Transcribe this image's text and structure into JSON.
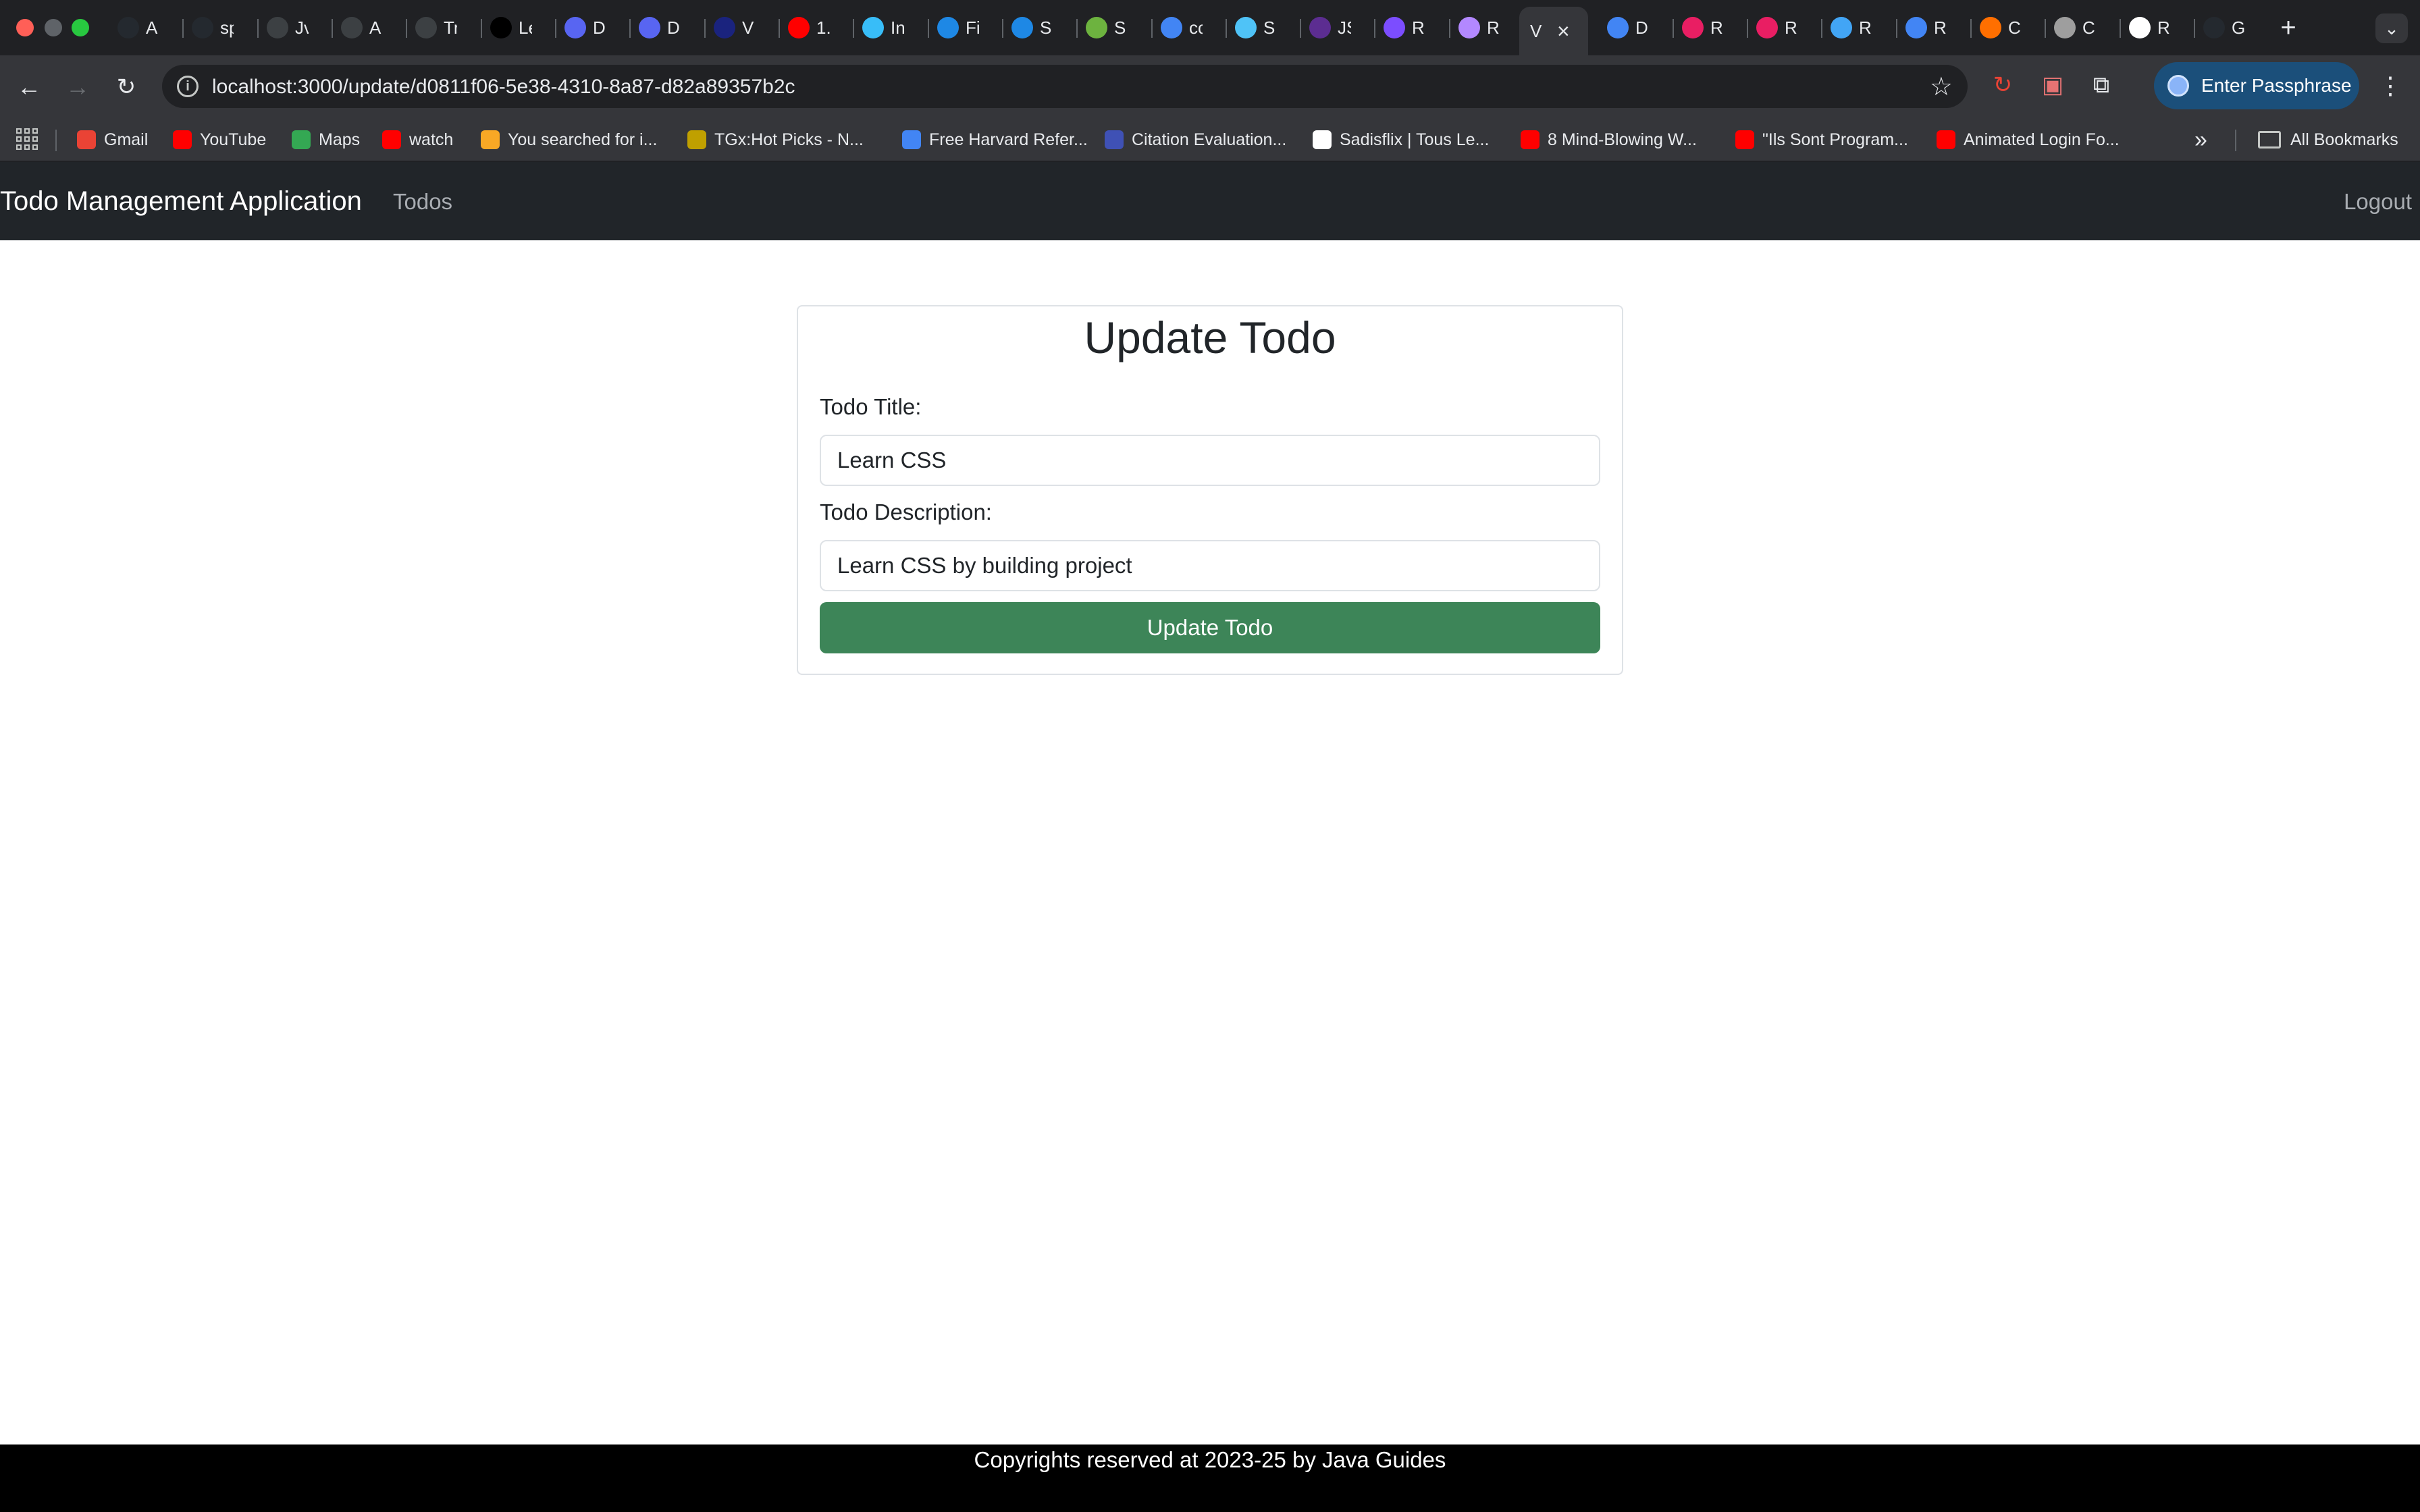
{
  "browser": {
    "tabs": [
      {
        "title": "A",
        "icon": "github-icon",
        "color": "#24292f"
      },
      {
        "title": "sp",
        "icon": "github-icon",
        "color": "#24292f"
      },
      {
        "title": "Jv",
        "icon": "openai-icon",
        "color": "#3c4043"
      },
      {
        "title": "A",
        "icon": "openai-icon",
        "color": "#3c4043"
      },
      {
        "title": "Tr",
        "icon": "openai-icon",
        "color": "#3c4043"
      },
      {
        "title": "Le",
        "icon": "triangle-icon",
        "color": "#000000"
      },
      {
        "title": "D",
        "icon": "dev-icon",
        "color": "#5865f2"
      },
      {
        "title": "D",
        "icon": "dev-icon",
        "color": "#5865f2"
      },
      {
        "title": "V",
        "icon": "v-icon",
        "color": "#1a237e"
      },
      {
        "title": "1.",
        "icon": "youtube-icon",
        "color": "#ff0000"
      },
      {
        "title": "In",
        "icon": "tailwind-icon",
        "color": "#38bdf8"
      },
      {
        "title": "Fi",
        "icon": "diamond-icon",
        "color": "#1e88e5"
      },
      {
        "title": "S",
        "icon": "diamond-icon",
        "color": "#1e88e5"
      },
      {
        "title": "S",
        "icon": "spring-icon",
        "color": "#6db33f"
      },
      {
        "title": "cc",
        "icon": "google-icon",
        "color": "#4285f4"
      },
      {
        "title": "S",
        "icon": "tools-icon",
        "color": "#4fc3f7"
      },
      {
        "title": "JS",
        "icon": "gear-icon",
        "color": "#5c2d91"
      },
      {
        "title": "R",
        "icon": "a-icon",
        "color": "#7c4dff"
      },
      {
        "title": "R",
        "icon": "a-icon",
        "color": "#b388ff"
      },
      {
        "title": "V",
        "icon": "close-icon",
        "color": "#35363a"
      },
      {
        "title": "D",
        "icon": "google-icon",
        "color": "#4285f4"
      },
      {
        "title": "R",
        "icon": "react-icon",
        "color": "#e91e63"
      },
      {
        "title": "R",
        "icon": "react-icon",
        "color": "#e91e63"
      },
      {
        "title": "R",
        "icon": "wave-icon",
        "color": "#42a5f5"
      },
      {
        "title": "R",
        "icon": "docs-icon",
        "color": "#4285f4"
      },
      {
        "title": "C",
        "icon": "c-icon",
        "color": "#ff6f00"
      },
      {
        "title": "C",
        "icon": "leaf-icon",
        "color": "#9e9e9e"
      },
      {
        "title": "R",
        "icon": "vc-icon",
        "color": "#ffffff"
      },
      {
        "title": "G",
        "icon": "github-icon",
        "color": "#24292f"
      }
    ],
    "active_tab_title": "V",
    "new_tab": "+",
    "url": "localhost:3000/update/d0811f06-5e38-4310-8a87-d82a89357b2c",
    "passphrase_button": "Enter Passphrase",
    "bookmarks": [
      {
        "label": "Gmail",
        "color": "#ea4335",
        "icon": "gmail-icon"
      },
      {
        "label": "YouTube",
        "color": "#ff0000",
        "icon": "youtube-icon"
      },
      {
        "label": "Maps",
        "color": "#34a853",
        "icon": "maps-icon"
      },
      {
        "label": "watch",
        "color": "#ff0000",
        "icon": "youtube-icon"
      },
      {
        "label": "You searched for i...",
        "color": "#f9a825",
        "icon": "g-icon"
      },
      {
        "label": "TGx:Hot Picks - N...",
        "color": "#c0a000",
        "icon": "tgx-icon"
      },
      {
        "label": "Free Harvard Refer...",
        "color": "#4285f4",
        "icon": "bookmark-icon"
      },
      {
        "label": "Citation Evaluation...",
        "color": "#3f51b5",
        "icon": "doc-icon"
      },
      {
        "label": "Sadisflix | Tous Le...",
        "color": "#ffffff",
        "icon": "blank-icon"
      },
      {
        "label": "8 Mind-Blowing W...",
        "color": "#ff0000",
        "icon": "youtube-icon"
      },
      {
        "label": "\"Ils Sont Program...",
        "color": "#ff0000",
        "icon": "youtube-icon"
      },
      {
        "label": "Animated Login Fo...",
        "color": "#ff0000",
        "icon": "youtube-icon"
      }
    ],
    "more_bookmarks": "»",
    "all_bookmarks": "All Bookmarks"
  },
  "navbar": {
    "brand": "Todo Management Application",
    "todos_link": "Todos",
    "logout_link": "Logout"
  },
  "form": {
    "heading": "Update Todo",
    "title_label": "Todo Title:",
    "title_value": "Learn CSS",
    "description_label": "Todo Description:",
    "description_value": "Learn CSS by building project",
    "submit_label": "Update Todo"
  },
  "footer": {
    "text": "Copyrights reserved at 2023-25 by Java Guides"
  },
  "colors": {
    "navbar_bg": "#212529",
    "submit_bg": "#3d8558",
    "footer_bg": "#000000"
  }
}
